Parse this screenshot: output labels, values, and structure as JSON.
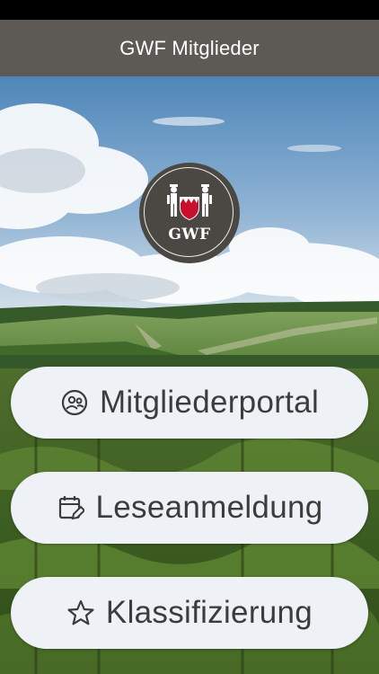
{
  "app_bar": {
    "title": "GWF Mitglieder"
  },
  "logo": {
    "text": "GWF"
  },
  "menu": {
    "items": [
      {
        "label": "Mitgliederportal",
        "icon": "member-portal-icon"
      },
      {
        "label": "Leseanmeldung",
        "icon": "calendar-edit-icon"
      },
      {
        "label": "Klassifizierung",
        "icon": "star-icon"
      }
    ]
  },
  "colors": {
    "app_bar": "#5d5a55",
    "button_bg": "#eef1f5",
    "button_text": "#3c3c3c",
    "logo_bg": "#4b4844",
    "emblem_red": "#c8102e"
  }
}
